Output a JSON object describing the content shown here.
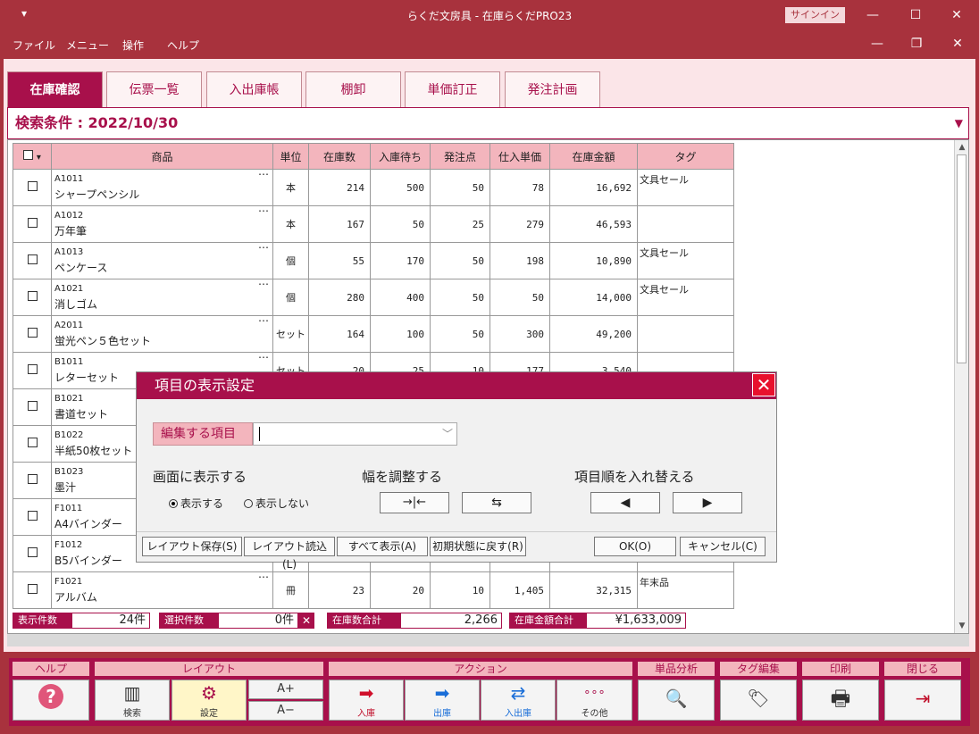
{
  "window": {
    "quick_menu": "▾",
    "title": "らくだ文房具  -  在庫らくだPRO23",
    "signin": "サインイン",
    "minimize": "—",
    "maximize": "☐",
    "close": "✕"
  },
  "menubar": {
    "items": [
      "ファイル",
      "メニュー",
      "操作",
      "ヘルプ"
    ],
    "min": "—",
    "restore": "❐",
    "close": "✕"
  },
  "tabs": [
    "在庫確認",
    "伝票一覧",
    "入出庫帳",
    "棚卸",
    "単価訂正",
    "発注計画"
  ],
  "search": {
    "label": "検索条件 : 2022/10/30",
    "dropdown": "▼"
  },
  "grid": {
    "columns": [
      "",
      "商品",
      "単位",
      "在庫数",
      "入庫待ち",
      "発注点",
      "仕入単価",
      "在庫金額",
      "タグ"
    ],
    "header_dropdown": "▾",
    "rows": [
      {
        "code": "A1011",
        "name": "シャープペンシル",
        "unit": "本",
        "stock": "214",
        "incoming": "500",
        "reorder": "50",
        "price": "78",
        "amount": "16,692",
        "tag": "文具セール"
      },
      {
        "code": "A1012",
        "name": "万年筆",
        "unit": "本",
        "stock": "167",
        "incoming": "50",
        "reorder": "25",
        "price": "279",
        "amount": "46,593",
        "tag": ""
      },
      {
        "code": "A1013",
        "name": "ペンケース",
        "unit": "個",
        "stock": "55",
        "incoming": "170",
        "reorder": "50",
        "price": "198",
        "amount": "10,890",
        "tag": "文具セール"
      },
      {
        "code": "A1021",
        "name": "消しゴム",
        "unit": "個",
        "stock": "280",
        "incoming": "400",
        "reorder": "50",
        "price": "50",
        "amount": "14,000",
        "tag": "文具セール"
      },
      {
        "code": "A2011",
        "name": "蛍光ペン５色セット",
        "unit": "セット",
        "stock": "164",
        "incoming": "100",
        "reorder": "50",
        "price": "300",
        "amount": "49,200",
        "tag": ""
      },
      {
        "code": "B1011",
        "name": "レターセット",
        "unit": "セット",
        "stock": "20",
        "incoming": "25",
        "reorder": "10",
        "price": "177",
        "amount": "3,540",
        "tag": ""
      },
      {
        "code": "B1021",
        "name": "書道セット",
        "unit": "",
        "stock": "",
        "incoming": "",
        "reorder": "",
        "price": "",
        "amount": "",
        "tag": ""
      },
      {
        "code": "B1022",
        "name": "半紙50枚セット",
        "unit": "",
        "stock": "",
        "incoming": "",
        "reorder": "",
        "price": "",
        "amount": "",
        "tag": ""
      },
      {
        "code": "B1023",
        "name": "墨汁",
        "unit": "",
        "stock": "",
        "incoming": "",
        "reorder": "",
        "price": "",
        "amount": "",
        "tag": ""
      },
      {
        "code": "F1011",
        "name": "A4バインダー",
        "unit": "",
        "stock": "",
        "incoming": "",
        "reorder": "",
        "price": "",
        "amount": "",
        "tag": ""
      },
      {
        "code": "F1012",
        "name": "B5バインダー",
        "unit": "",
        "stock": "",
        "incoming": "",
        "reorder": "",
        "price": "",
        "amount": "",
        "tag": ""
      },
      {
        "code": "F1021",
        "name": "アルバム",
        "unit": "冊",
        "stock": "23",
        "incoming": "20",
        "reorder": "10",
        "price": "1,405",
        "amount": "32,315",
        "tag": "年末品"
      }
    ]
  },
  "summary": {
    "count_label": "表示件数",
    "count_value": "24件",
    "selected_label": "選択件数",
    "selected_value": "0件",
    "selected_clear": "✕",
    "stock_label": "在庫数合計",
    "stock_value": "2,266",
    "amount_label": "在庫金額合計",
    "amount_value": "¥1,633,009"
  },
  "toolbar": {
    "groups": {
      "help": "ヘルプ",
      "layout": "レイアウト",
      "action": "アクション",
      "analysis": "単品分析",
      "tag": "タグ編集",
      "print": "印刷",
      "close": "閉じる"
    },
    "buttons": {
      "search": "検索",
      "settings": "設定",
      "font_up": "A+",
      "font_down": "A−",
      "in": "入庫",
      "out": "出庫",
      "inout": "入出庫",
      "other": "その他"
    },
    "icons": {
      "help": "?",
      "search": "▥",
      "settings": "⚙",
      "in": "➡",
      "out": "➡",
      "inout": "⇄",
      "other": "∘∘∘",
      "analysis": "🔍",
      "tag": "🏷",
      "print": "🖶",
      "close": "⇥"
    }
  },
  "dialog": {
    "title": "項目の表示設定",
    "close": "✕",
    "field_label": "編集する項目",
    "field_chevron": "﹀",
    "section_display": "画面に表示する",
    "radio_show": "表示する",
    "radio_hide": "表示しない",
    "section_width": "幅を調整する",
    "width_narrow": "→|←",
    "width_wide": "⇆",
    "section_order": "項目順を入れ替える",
    "order_left": "◀",
    "order_right": "▶",
    "btn_save": "レイアウト保存(S)",
    "btn_load": "レイアウト読込(L)",
    "btn_showall": "すべて表示(A)",
    "btn_reset": "初期状態に戻す(R)",
    "btn_ok": "OK(O)",
    "btn_cancel": "キャンセル(C)"
  }
}
